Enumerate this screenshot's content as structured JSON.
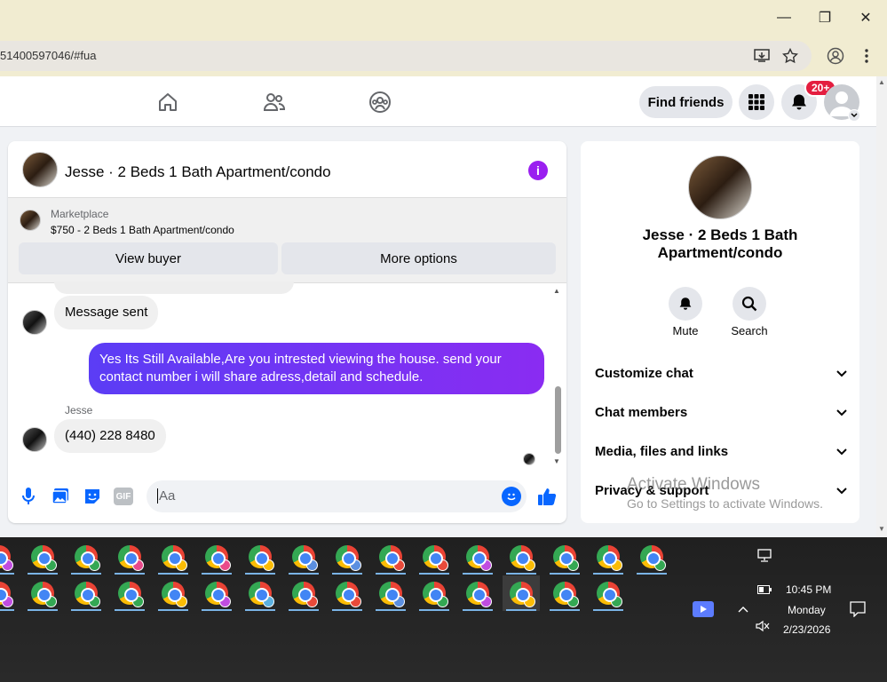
{
  "window": {
    "minimize": "—",
    "restore": "❐",
    "close": "✕"
  },
  "browser": {
    "url": "51400597046/#fua"
  },
  "nav": {
    "find_friends": "Find friends",
    "notif_badge": "20+"
  },
  "chat": {
    "title": "Jesse · 2 Beds 1 Bath Apartment/condo",
    "marketplace_label": "Marketplace",
    "listing": "$750 - 2 Beds 1 Bath Apartment/condo",
    "view_buyer": "View buyer",
    "more_options": "More options",
    "messages": [
      {
        "from": "them",
        "text": "Message sent"
      },
      {
        "from": "me",
        "text": "Yes Its Still Available,Are you intrested viewing the house. send your contact number i will share adress,detail and schedule."
      },
      {
        "from": "them",
        "sender": "Jesse",
        "text": "(440) 228 8480"
      }
    ],
    "composer_placeholder": "Aa",
    "gif_label": "GIF"
  },
  "sidebar": {
    "name_line1": "Jesse · 2 Beds 1 Bath",
    "name_line2": "Apartment/condo",
    "mute": "Mute",
    "search": "Search",
    "rows": [
      "Customize chat",
      "Chat members",
      "Media, files and links",
      "Privacy & support"
    ]
  },
  "watermark": {
    "line1": "Activate Windows",
    "line2": "Go to Settings to activate Windows."
  },
  "tray": {
    "time": "10:45 PM",
    "day": "Monday",
    "date": "2/23/2026"
  },
  "colors": {
    "accent": "#7a2cf0",
    "fb_blue": "#0866ff",
    "badge": "#e41e3f",
    "purple_bubble": "#7b2ff2"
  }
}
